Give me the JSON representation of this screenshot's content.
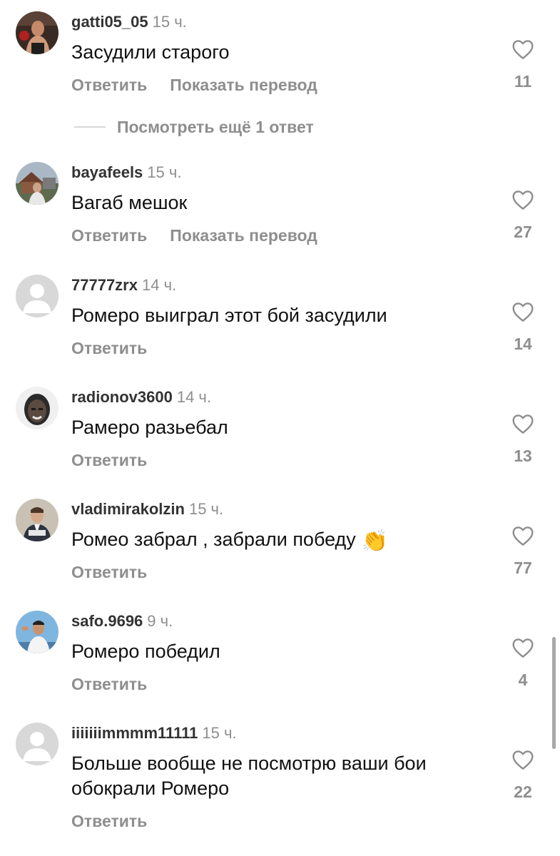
{
  "comments": [
    {
      "username": "gatti05_05",
      "time": "15 ч.",
      "text": "Засудили старого",
      "reply_label": "Ответить",
      "translate_label": "Показать перевод",
      "likes": "11",
      "avatar": "photo-boxer"
    },
    {
      "username": "bayafeels",
      "time": "15 ч.",
      "text": "Вагаб мешок",
      "reply_label": "Ответить",
      "translate_label": "Показать перевод",
      "likes": "27",
      "avatar": "photo-house"
    },
    {
      "username": "77777zrx",
      "time": "14 ч.",
      "text": "Ромеро выиграл этот бой засудили",
      "reply_label": "Ответить",
      "likes": "14",
      "avatar": "default-avatar-icon"
    },
    {
      "username": "radionov3600",
      "time": "14 ч.",
      "text": "Рамеро разьебал",
      "reply_label": "Ответить",
      "likes": "13",
      "avatar": "photo-portrait-bw"
    },
    {
      "username": "vladimirakolzin",
      "time": "15 ч.",
      "text": "Ромео забрал , забрали победу",
      "emoji": "👏",
      "reply_label": "Ответить",
      "likes": "77",
      "avatar": "photo-man-suit"
    },
    {
      "username": "safo.9696",
      "time": "9 ч.",
      "text": "Ромеро победил",
      "reply_label": "Ответить",
      "likes": "4",
      "avatar": "photo-man-sky"
    },
    {
      "username": "iiiiiiimmmm11111",
      "time": "15 ч.",
      "text": "Больше вообще не посмотрю ваши бои обокрали Ромеро",
      "reply_label": "Ответить",
      "likes": "22",
      "avatar": "default-avatar-icon"
    }
  ],
  "more_replies_label": "Посмотреть ещё 1 ответ",
  "colors": {
    "username": "#333333",
    "secondary": "#8e8e8e",
    "text": "#111111",
    "heart_outline": "#8e8e8e"
  }
}
